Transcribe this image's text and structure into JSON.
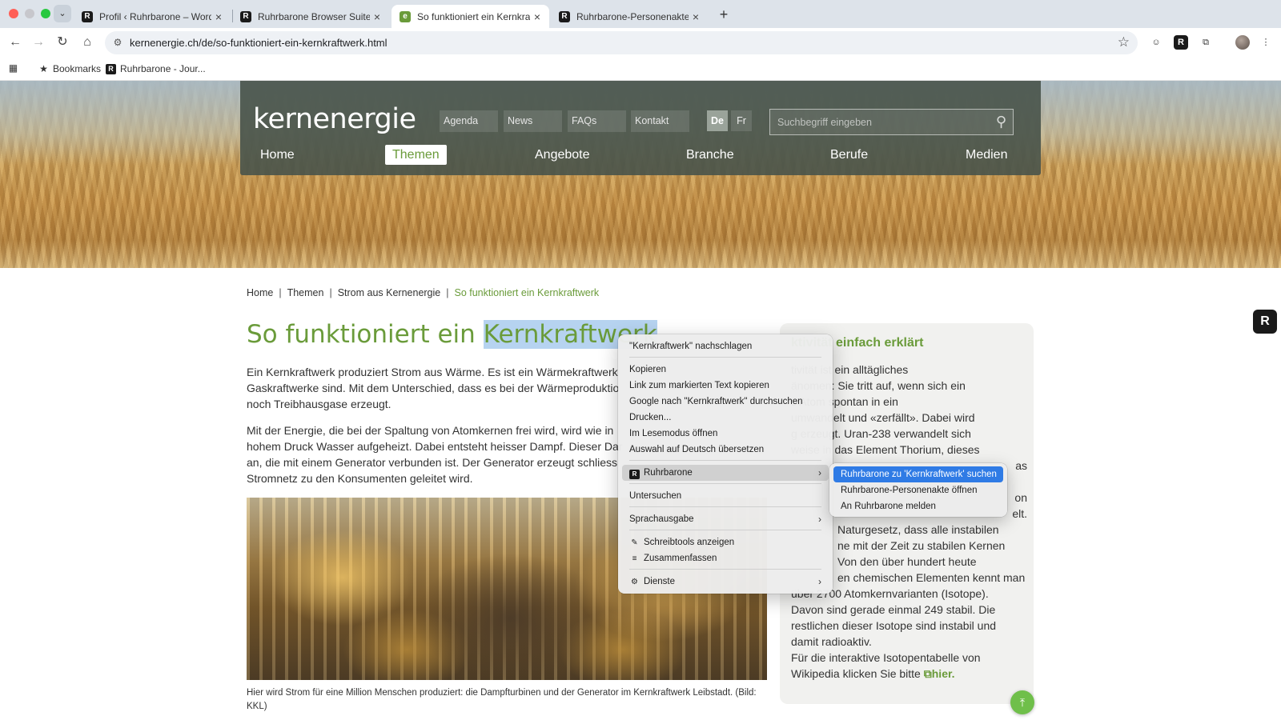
{
  "browser": {
    "tabs": [
      {
        "favicon": "R",
        "title": "Profil ‹ Ruhrbarone – WordPress"
      },
      {
        "favicon": "R",
        "title": "Ruhrbarone Browser Suite Options"
      },
      {
        "favicon": "e",
        "title": "So funktioniert ein Kernkraftwerk"
      },
      {
        "favicon": "R",
        "title": "Ruhrbarone-Personenakte"
      }
    ],
    "url": "kernenergie.ch/de/so-funktioniert-ein-kernkraftwerk.html",
    "bookmarks": {
      "folder": "Bookmarks",
      "item": "Ruhrbarone - Jour..."
    }
  },
  "site": {
    "logo": "kernenergie",
    "meta_links": [
      "Agenda",
      "News",
      "FAQs",
      "Kontakt"
    ],
    "languages": [
      "De",
      "Fr"
    ],
    "search_placeholder": "Suchbegriff eingeben",
    "main_nav": [
      "Home",
      "Themen",
      "Angebote",
      "Branche",
      "Berufe",
      "Medien"
    ]
  },
  "breadcrumb": [
    "Home",
    "Themen",
    "Strom aus Kernenergie",
    "So funktioniert ein Kernkraftwerk"
  ],
  "article": {
    "title_prefix": "So funktioniert ein",
    "title_selected": "Kernkraftwerk",
    "p1": [
      "Ein Kernkraftwerk produziert Strom aus Wärme. Es ist ein Wärmekraftwerk",
      "Gaskraftwerke sind. Mit dem Unterschied, dass es bei der Wärmeproduktio",
      "noch Treibhausgase erzeugt."
    ],
    "p2": [
      "Mit der Energie, die bei der Spaltung von Atomkernen frei wird, wird wie in",
      "hohem Druck Wasser aufgeheizt. Dabei entsteht heisser Dampf. Dieser Dar",
      "an, die mit einem Generator verbunden ist. Der Generator erzeugt schliess",
      "Stromnetz zu den Konsumenten geleitet wird."
    ],
    "caption": "Hier wird Strom für eine Million Menschen produziert: die Dampfturbinen und der Generator im Kernkraftwerk Leibstadt. (Bild: KKL)"
  },
  "sidebar": {
    "title": "ktivität einfach erklärt",
    "lines": [
      "tivität ist ein alltägliches",
      "änomen: Sie tritt auf, wenn sich ein",
      "s Atom spontan in ein",
      "umwandelt und «zerfällt». Dabei wird",
      "g erzeugt. Uran-238 verwandelt sich",
      "weise in das Element Thorium, dieses",
      "as",
      "",
      "on",
      "elt.",
      "Naturgesetz, dass alle instabilen",
      "ne mit der Zeit zu stabilen Kernen",
      "Von den über hundert heute",
      "en chemischen Elementen kennt man",
      "über 2700 Atomkernvarianten (Isotope).",
      "Davon sind gerade einmal 249 stabil. Die",
      "restlichen dieser Isotope sind instabil und",
      "damit radioaktiv.",
      "Für die interaktive Isotopentabelle von",
      "Wikipedia klicken Sie bitte"
    ],
    "link": "hier."
  },
  "context_menu": {
    "lookup": "\"Kernkraftwerk\" nachschlagen",
    "copy": "Kopieren",
    "copy_link": "Link zum markierten Text kopieren",
    "google": "Google nach \"Kernkraftwerk\" durchsuchen",
    "print": "Drucken...",
    "reader": "Im Lesemodus öffnen",
    "translate": "Auswahl auf Deutsch übersetzen",
    "ruhrbarone": "Ruhrbarone",
    "inspect": "Untersuchen",
    "speech": "Sprachausgabe",
    "writing_tools": "Schreibtools anzeigen",
    "summarize": "Zusammenfassen",
    "services": "Dienste"
  },
  "submenu": {
    "search": "Ruhrbarone zu 'Kernkraftwerk' suchen",
    "open_file": "Ruhrbarone-Personenakte öffnen",
    "report": "An Ruhrbarone melden"
  }
}
